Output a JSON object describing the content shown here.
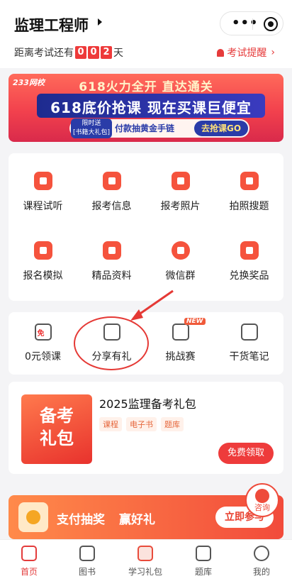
{
  "header": {
    "title": "监理工程师",
    "countdown_prefix": "距离考试还有",
    "countdown_digits": [
      "0",
      "0",
      "2"
    ],
    "countdown_unit": "天",
    "reminder": "考试提醒"
  },
  "banner": {
    "brand": "233网校",
    "line1": "618火力全开 直达通关",
    "line2": "618底价抢课 现在买课巨便宜",
    "promo_tag_top": "限时送",
    "promo_tag_bottom": "[书籍大礼包]",
    "promo_middle": "付款抽黄金手链",
    "promo_go": "去抢课GO"
  },
  "grid": [
    {
      "label": "课程试听",
      "color": "#f5533d"
    },
    {
      "label": "报考信息",
      "color": "#f5533d"
    },
    {
      "label": "报考照片",
      "color": "#f5533d"
    },
    {
      "label": "拍照搜题",
      "color": "#f5533d"
    },
    {
      "label": "报名模拟",
      "color": "#f5533d"
    },
    {
      "label": "精品资料",
      "color": "#f5533d"
    },
    {
      "label": "微信群",
      "color": "#f5533d"
    },
    {
      "label": "兑换奖品",
      "color": "#f5533d"
    }
  ],
  "features": [
    {
      "label": "0元领课",
      "badge": "免"
    },
    {
      "label": "分享有礼"
    },
    {
      "label": "挑战赛",
      "badge": "NEW"
    },
    {
      "label": "干货笔记"
    }
  ],
  "gift": {
    "thumb_text_1": "备考",
    "thumb_text_2": "礼包",
    "title": "2025监理备考礼包",
    "tags": [
      "课程",
      "电子书",
      "题库"
    ],
    "button": "免费领取"
  },
  "consult": {
    "label": "咨询"
  },
  "lottery": {
    "text1": "支付抽奖",
    "text2": "赢好礼",
    "button": "立即参与"
  },
  "tabbar": [
    {
      "label": "首页",
      "active": true
    },
    {
      "label": "图书"
    },
    {
      "label": "学习礼包"
    },
    {
      "label": "题库"
    },
    {
      "label": "我的"
    }
  ],
  "colors": {
    "accent": "#e33b3b",
    "banner": "#f2414d"
  }
}
